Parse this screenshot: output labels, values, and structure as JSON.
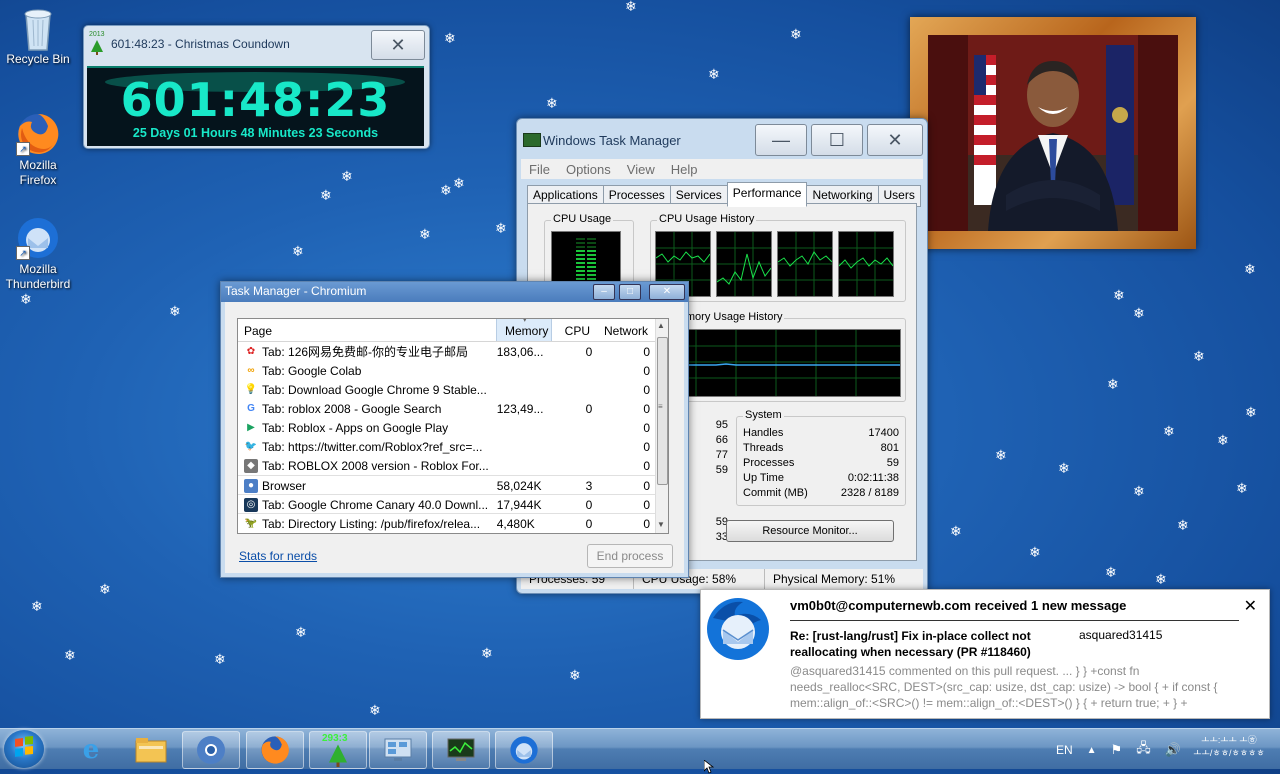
{
  "desktop": {
    "icons": [
      {
        "label": "Recycle Bin",
        "icon": "recycle-bin-icon"
      },
      {
        "label": "Mozilla Firefox",
        "icon": "firefox-icon"
      },
      {
        "label": "Mozilla Thunderbird",
        "icon": "thunderbird-icon"
      }
    ]
  },
  "countdown": {
    "window_title": "601:48:23 - Christmas Coundown",
    "badge": "2013",
    "digits": "601:48:23",
    "subtitle": "25 Days 01 Hours 48 Minutes 23 Seconds"
  },
  "windows_task_manager": {
    "title": "Windows Task Manager",
    "menu": [
      "File",
      "Options",
      "View",
      "Help"
    ],
    "tabs": [
      "Applications",
      "Processes",
      "Services",
      "Performance",
      "Networking",
      "Users"
    ],
    "active_tab": "Performance",
    "cpu_usage_label": "CPU Usage",
    "cpu_history_label": "CPU Usage History",
    "memory_history_label": "al Memory Usage History",
    "left_partial_numbers": [
      "95",
      "66",
      "77",
      "59",
      "59",
      "33"
    ],
    "system": {
      "label": "System",
      "rows": [
        {
          "key": "Handles",
          "value": "17400"
        },
        {
          "key": "Threads",
          "value": "801"
        },
        {
          "key": "Processes",
          "value": "59"
        },
        {
          "key": "Up Time",
          "value": "0:02:11:38"
        },
        {
          "key": "Commit (MB)",
          "value": "2328 / 8189"
        }
      ]
    },
    "resource_monitor_button": "Resource Monitor...",
    "status": {
      "processes": "Processes: 59",
      "cpu": "CPU Usage: 58%",
      "memory": "Physical Memory: 51%"
    }
  },
  "chromium_task_manager": {
    "title": "Task Manager - Chromium",
    "columns": {
      "page": "Page",
      "memory": "Memory",
      "cpu": "CPU",
      "network": "Network"
    },
    "rows": [
      {
        "icon": "126-mail-icon",
        "page": "Tab: 126网易免费邮-你的专业电子邮局",
        "memory": "183,06...",
        "cpu": "0",
        "network": "0"
      },
      {
        "icon": "colab-icon",
        "page": "Tab: Google Colab",
        "memory": "",
        "cpu": "",
        "network": "0"
      },
      {
        "icon": "lightbulb-icon",
        "page": "Tab: Download Google Chrome 9 Stable...",
        "memory": "",
        "cpu": "",
        "network": "0"
      },
      {
        "icon": "google-icon",
        "page": "Tab: roblox 2008 - Google Search",
        "memory": "123,49...",
        "cpu": "0",
        "network": "0"
      },
      {
        "icon": "google-play-icon",
        "page": "Tab: Roblox - Apps on Google Play",
        "memory": "",
        "cpu": "",
        "network": "0"
      },
      {
        "icon": "twitter-icon",
        "page": "Tab: https://twitter.com/Roblox?ref_src=...",
        "memory": "",
        "cpu": "",
        "network": "0"
      },
      {
        "icon": "roblox-icon",
        "page": "Tab: ROBLOX 2008 version - Roblox For...",
        "memory": "",
        "cpu": "",
        "network": "0"
      },
      {
        "icon": "chromium-icon",
        "page": "Browser",
        "memory": "58,024K",
        "cpu": "3",
        "network": "0"
      },
      {
        "icon": "chrome-canary-icon",
        "page": "Tab: Google Chrome Canary 40.0 Downl...",
        "memory": "17,944K",
        "cpu": "0",
        "network": "0"
      },
      {
        "icon": "firefox-dino-icon",
        "page": "Tab: Directory Listing: /pub/firefox/relea...",
        "memory": "4,480K",
        "cpu": "0",
        "network": "0"
      }
    ],
    "stats_link": "Stats for nerds",
    "end_process": "End process"
  },
  "notification": {
    "title": "vm0b0t@computernewb.com received 1 new message",
    "subject": "Re: [rust-lang/rust] Fix in-place collect not reallocating when necessary (PR #118460)",
    "sender": "asquared31415",
    "preview": "@asquared31415 commented on this pull request. ... } } +const fn needs_realloc<SRC, DEST>(src_cap: usize, dst_cap: usize) -> bool { + if const { mem::align_of::<SRC>() != mem::align_of::<DEST>() } { + return true; + } +"
  },
  "taskbar": {
    "countdown_badge": "293:3",
    "language": "EN",
    "clock_line1": "ㅗㅗ:ㅗㅗ ㅗ㉭",
    "clock_line2": "ㅗㅗ/ㅎㅎ/ㅎㅎㅎㅎ"
  },
  "colors": {
    "desktop": "#1f62b4",
    "countdown_text": "#18e8c8",
    "graph_green": "#19c53a",
    "link": "#0b4ea8"
  }
}
